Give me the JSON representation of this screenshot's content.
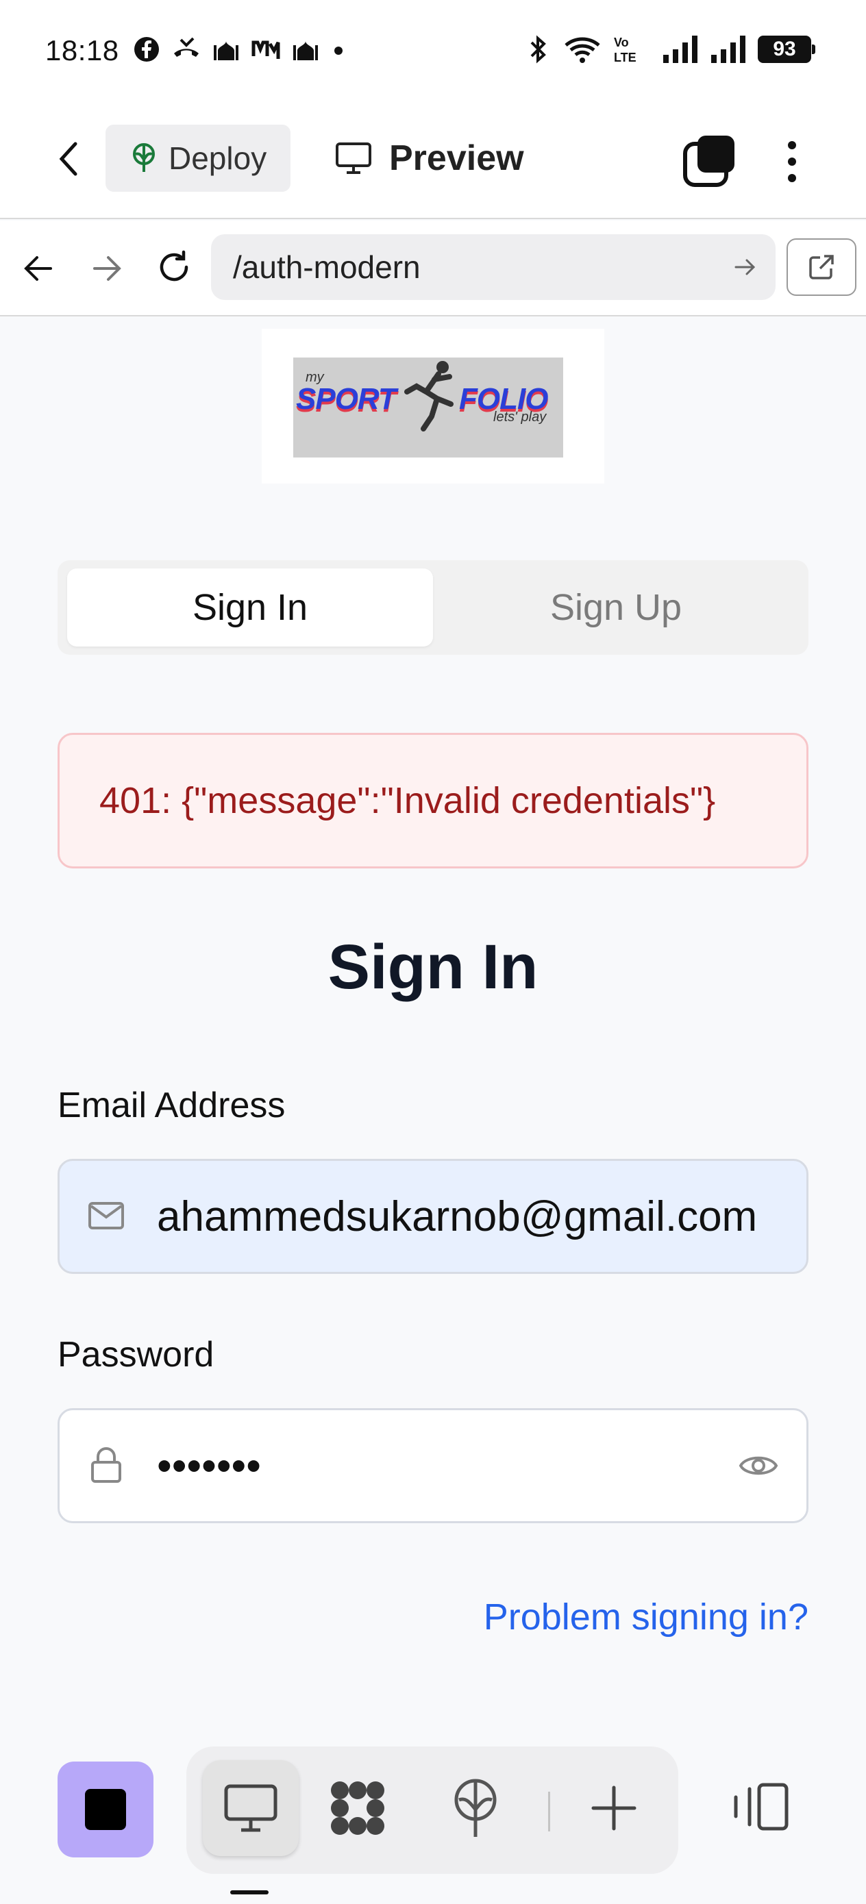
{
  "status_bar": {
    "time": "18:18",
    "battery": "93",
    "icons_left": [
      "facebook-icon",
      "missed-call-icon",
      "mosque-icon",
      "app-icon",
      "mosque-icon",
      "dot-icon"
    ],
    "icons_right": [
      "bluetooth-icon",
      "wifi-icon",
      "volte-icon",
      "signal-icon",
      "signal-icon"
    ]
  },
  "header": {
    "deploy_label": "Deploy",
    "preview_label": "Preview"
  },
  "browser": {
    "url": "/auth-modern"
  },
  "logo": {
    "my": "my",
    "sport": "SPORT",
    "folio": "FOLIO",
    "tagline": "lets' play"
  },
  "auth_tabs": {
    "sign_in": "Sign In",
    "sign_up": "Sign Up",
    "active": "Sign In"
  },
  "error": {
    "message": "401: {\"message\":\"Invalid credentials\"}"
  },
  "form": {
    "title": "Sign In",
    "email_label": "Email Address",
    "email_value": "ahammedsukarnob@gmail.com",
    "password_label": "Password",
    "password_value": "•••••••",
    "help_link": "Problem signing in?"
  },
  "colors": {
    "accent": "#2563eb",
    "error_text": "#9b1c1c",
    "error_bg": "#fef2f2",
    "stop_button": "#b7a8f9",
    "deploy_icon": "#1a7a3a"
  }
}
